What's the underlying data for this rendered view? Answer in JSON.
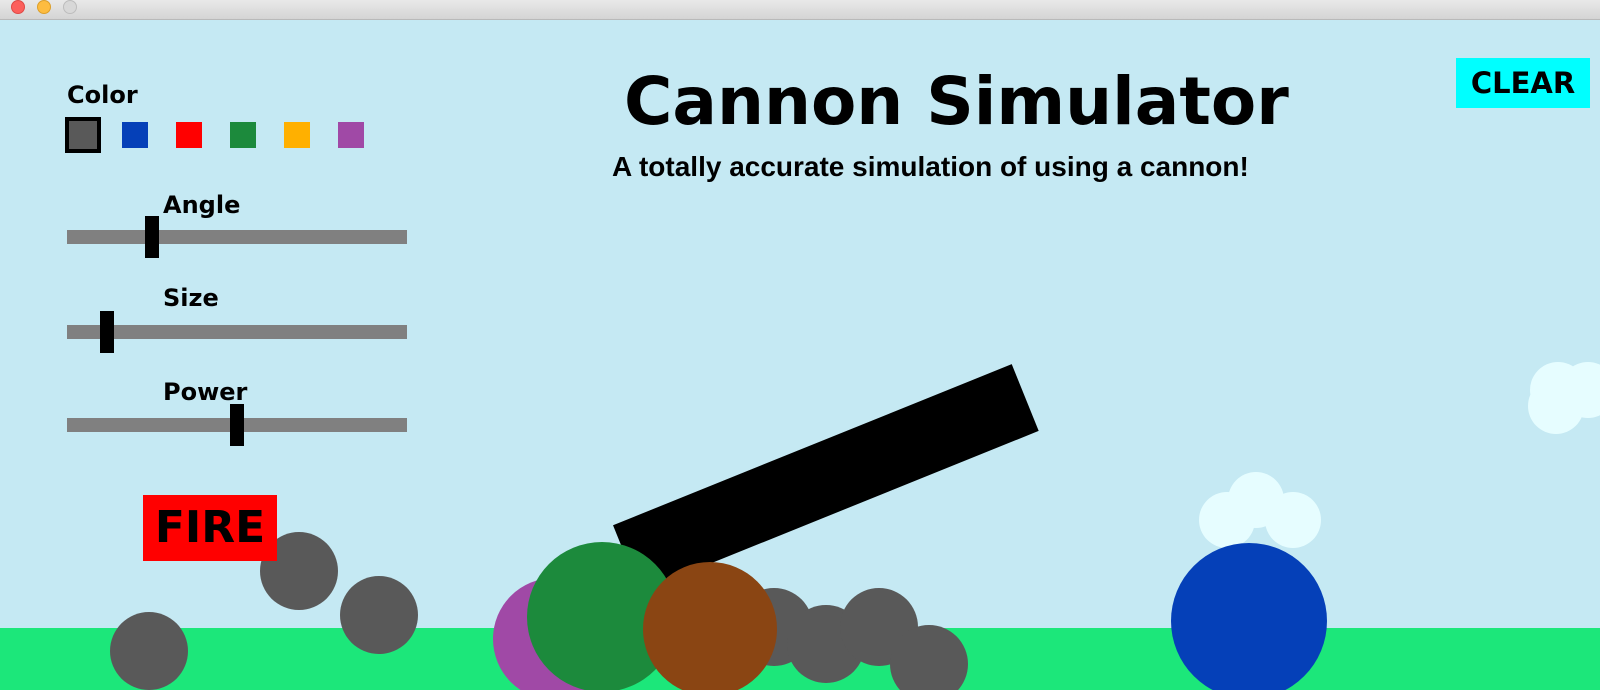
{
  "window": {
    "controls": [
      "close",
      "minimize",
      "maximize"
    ]
  },
  "header": {
    "title": "Cannon Simulator",
    "subtitle": "A totally accurate simulation of using a cannon!"
  },
  "toolbar": {
    "clear_label": "CLEAR",
    "fire_label": "FIRE"
  },
  "palette": {
    "label": "Color",
    "selected": "gray",
    "swatches": [
      {
        "name": "gray",
        "color": "#595959"
      },
      {
        "name": "blue",
        "color": "#0540b8"
      },
      {
        "name": "red",
        "color": "#ff0000"
      },
      {
        "name": "green",
        "color": "#1c8a3c"
      },
      {
        "name": "orange",
        "color": "#ffb000"
      },
      {
        "name": "purple",
        "color": "#a049a6"
      }
    ]
  },
  "sliders": {
    "angle": {
      "label": "Angle",
      "value": 0.24
    },
    "size": {
      "label": "Size",
      "value": 0.1
    },
    "power": {
      "label": "Power",
      "value": 0.5
    }
  },
  "colors": {
    "sky": "#c5e9f3",
    "ground": "#1ce77a",
    "cannon": "#000000",
    "cloud": "#e6fdff",
    "clear_button": "#00ffff",
    "fire_button": "#ff0000",
    "slider_track": "#808080"
  },
  "cannonballs": [
    {
      "color": "gray"
    },
    {
      "color": "gray"
    },
    {
      "color": "gray"
    },
    {
      "color": "purple"
    },
    {
      "color": "green"
    },
    {
      "color": "gray"
    },
    {
      "color": "gray"
    },
    {
      "color": "gray"
    },
    {
      "color": "gray"
    },
    {
      "color": "brown"
    },
    {
      "color": "blue"
    }
  ]
}
